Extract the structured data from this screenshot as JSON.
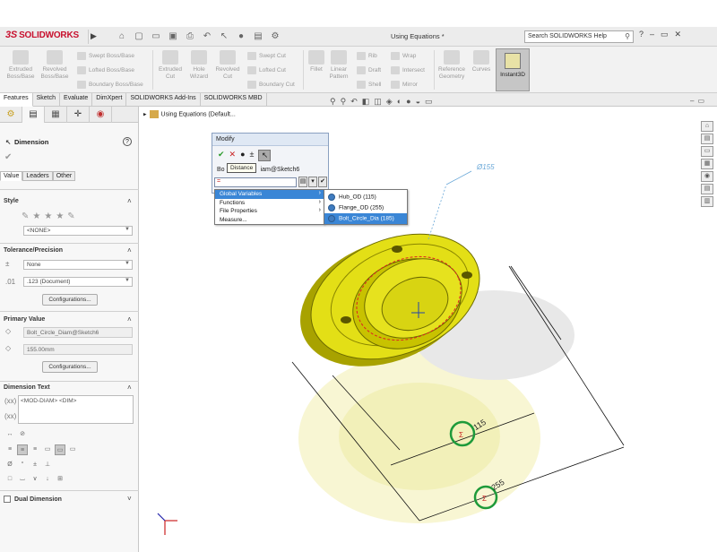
{
  "app": {
    "brand": "SOLIDWORKS",
    "brand_prefix": "3S",
    "doc_title": "Using Equations *",
    "search_placeholder": "Search SOLIDWORKS Help"
  },
  "ribbon": {
    "extruded_boss": "Extruded Boss/Base",
    "revolved_boss": "Revolved Boss/Base",
    "swept_boss": "Swept Boss/Base",
    "lofted_boss": "Lofted Boss/Base",
    "boundary_boss": "Boundary Boss/Base",
    "extruded_cut": "Extruded Cut",
    "hole_wizard": "Hole Wizard",
    "revolved_cut": "Revolved Cut",
    "swept_cut": "Swept Cut",
    "lofted_cut": "Lofted Cut",
    "boundary_cut": "Boundary Cut",
    "fillet": "Fillet",
    "linear_pattern": "Linear Pattern",
    "rib": "Rib",
    "draft": "Draft",
    "shell": "Shell",
    "wrap": "Wrap",
    "intersect": "Intersect",
    "mirror": "Mirror",
    "reference_geometry": "Reference Geometry",
    "curves": "Curves",
    "instant3d": "Instant3D"
  },
  "tabs": [
    "Features",
    "Sketch",
    "Evaluate",
    "DimXpert",
    "SOLIDWORKS Add-Ins",
    "SOLIDWORKS MBD"
  ],
  "panel": {
    "title": "Dimension",
    "subtabs": [
      "Value",
      "Leaders",
      "Other"
    ],
    "style_header": "Style",
    "style_value": "<NONE>",
    "tolerance_header": "Tolerance/Precision",
    "tolerance_value": "None",
    "precision_value": ".123 (Document)",
    "configurations_btn": "Configurations...",
    "primary_header": "Primary Value",
    "primary_name": "Bolt_Circle_Diam@Sketch6",
    "primary_value": "155.00mm",
    "configurations_btn2": "Configurations...",
    "dimtext_header": "Dimension Text",
    "dimtext_value": "<MOD-DIAM> <DIM>",
    "dual_dimension": "Dual Dimension"
  },
  "tree": {
    "root": "Using Equations  (Default..."
  },
  "modify": {
    "title": "Modify",
    "tooltip": "Distance",
    "name_prefix": "Bo",
    "name_suffix": "iam@Sketch6",
    "input_value": "="
  },
  "menu_main": [
    "Global Variables",
    "Functions",
    "File Properties",
    "Measure..."
  ],
  "menu_globals": [
    "Hub_OD (115)",
    "Flange_OD (255)",
    "Bolt_Circle_Dia (185)"
  ],
  "dimensions": {
    "bolt_circle": "155",
    "hub": "115",
    "flange": "255"
  },
  "colors": {
    "part": "#e3df16",
    "highlight": "#3a86d6",
    "dimension_blue": "#6aa8d8",
    "circle_marker": "#1e9a3a"
  }
}
